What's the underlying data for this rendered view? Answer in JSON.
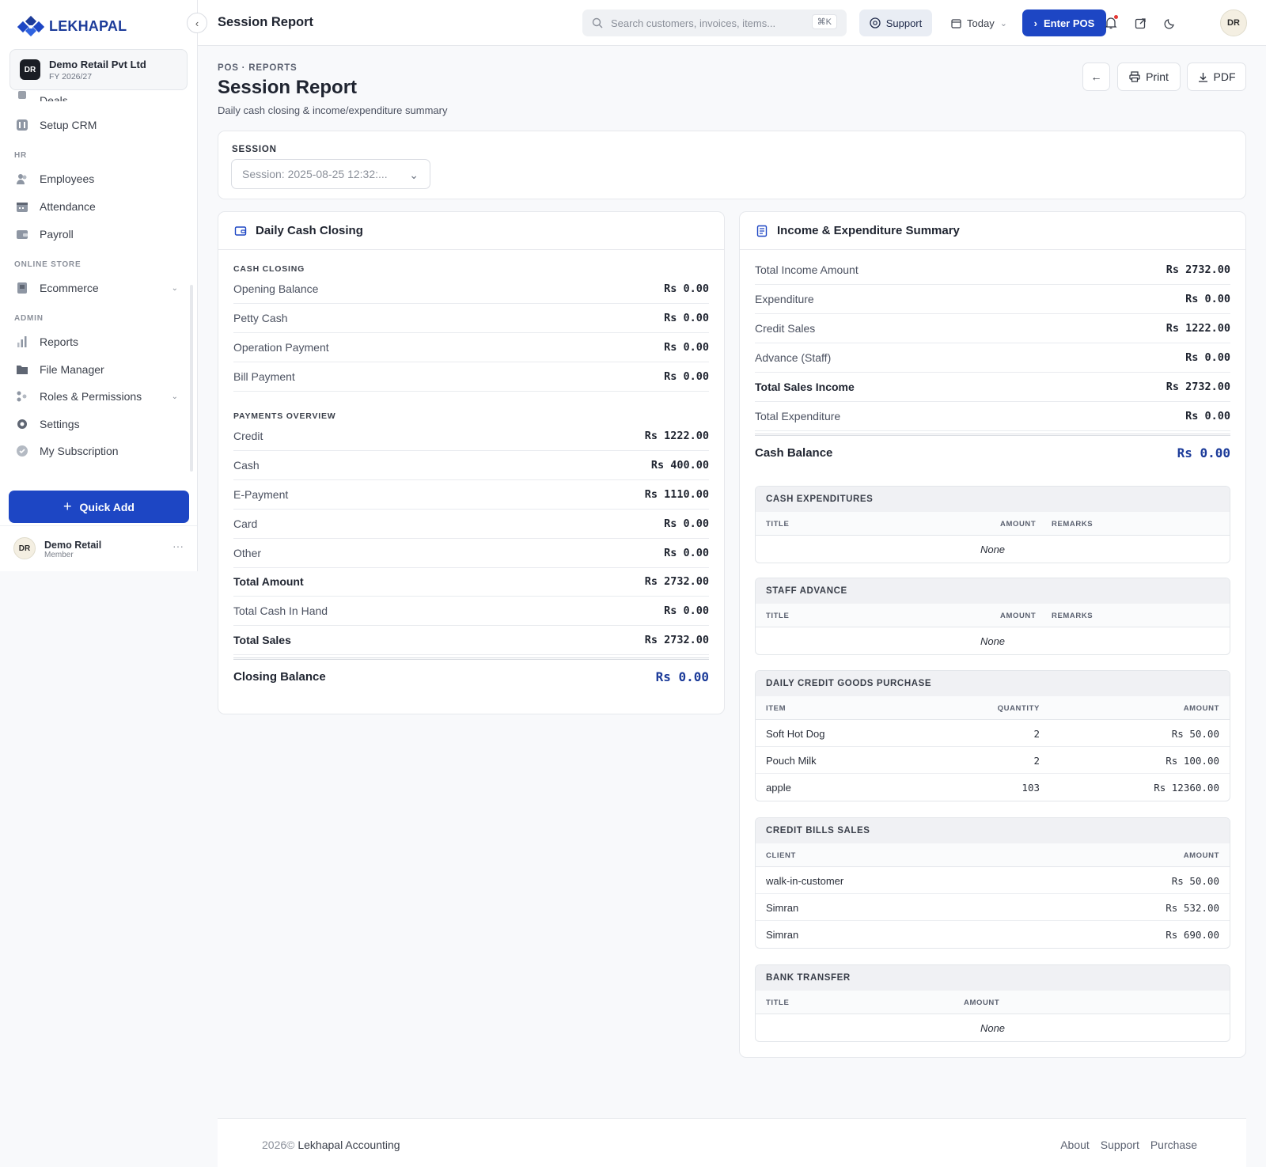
{
  "brand": {
    "name": "LEKHAPAL"
  },
  "org": {
    "badge": "DR",
    "name": "Demo Retail Pvt Ltd",
    "fy": "FY 2026/27"
  },
  "sidebar": {
    "partial_item": "Deals",
    "items_crm": [
      {
        "label": "Setup CRM",
        "icon": "crm-setup-icon"
      }
    ],
    "section_hr": "HR",
    "items_hr": [
      {
        "label": "Employees",
        "icon": "users-icon"
      },
      {
        "label": "Attendance",
        "icon": "calendar-icon"
      },
      {
        "label": "Payroll",
        "icon": "wallet-icon"
      }
    ],
    "section_store": "ONLINE STORE",
    "items_store": [
      {
        "label": "Ecommerce",
        "icon": "store-icon"
      }
    ],
    "section_admin": "ADMIN",
    "items_admin": [
      {
        "label": "Reports",
        "icon": "bar-chart-icon"
      },
      {
        "label": "File Manager",
        "icon": "folder-icon"
      },
      {
        "label": "Roles & Permissions",
        "icon": "roles-icon"
      },
      {
        "label": "Settings",
        "icon": "gear-icon"
      },
      {
        "label": "My Subscription",
        "icon": "badge-check-icon"
      }
    ],
    "quick_add": "Quick Add",
    "user": {
      "initials": "DR",
      "name": "Demo Retail",
      "role": "Member"
    }
  },
  "topbar": {
    "title": "Session Report",
    "search_placeholder": "Search customers, invoices, items...",
    "shortcut": "⌘K",
    "support": "Support",
    "date_filter": "Today",
    "enter_pos": "Enter POS",
    "avatar": "DR"
  },
  "header": {
    "breadcrumb": "POS · REPORTS",
    "title": "Session Report",
    "subtitle": "Daily cash closing & income/expenditure summary",
    "print": "Print",
    "pdf": "PDF"
  },
  "session": {
    "label": "SESSION",
    "value": "Session: 2025-08-25 12:32:..."
  },
  "cash_closing": {
    "title": "Daily Cash Closing",
    "section_cash": "CASH CLOSING",
    "cash_rows": [
      {
        "label": "Opening Balance",
        "value": "Rs 0.00"
      },
      {
        "label": "Petty Cash",
        "value": "Rs 0.00"
      },
      {
        "label": "Operation Payment",
        "value": "Rs 0.00"
      },
      {
        "label": "Bill Payment",
        "value": "Rs 0.00"
      }
    ],
    "section_payments": "PAYMENTS OVERVIEW",
    "payment_rows": [
      {
        "label": "Credit",
        "value": "Rs 1222.00"
      },
      {
        "label": "Cash",
        "value": "Rs 400.00"
      },
      {
        "label": "E-Payment",
        "value": "Rs 1110.00"
      },
      {
        "label": "Card",
        "value": "Rs 0.00"
      },
      {
        "label": "Other",
        "value": "Rs 0.00"
      },
      {
        "label": "Total Amount",
        "value": "Rs 2732.00"
      },
      {
        "label": "Total Cash In Hand",
        "value": "Rs 0.00"
      },
      {
        "label": "Total Sales",
        "value": "Rs 2732.00"
      }
    ],
    "closing": {
      "label": "Closing Balance",
      "value": "Rs 0.00"
    }
  },
  "summary": {
    "title": "Income & Expenditure Summary",
    "rows": [
      {
        "label": "Total Income Amount",
        "value": "Rs 2732.00"
      },
      {
        "label": "Expenditure",
        "value": "Rs 0.00"
      },
      {
        "label": "Credit Sales",
        "value": "Rs 1222.00"
      },
      {
        "label": "Advance (Staff)",
        "value": "Rs 0.00"
      },
      {
        "label": "Total Sales Income",
        "value": "Rs 2732.00"
      },
      {
        "label": "Total Expenditure",
        "value": "Rs 0.00"
      }
    ],
    "cash_balance": {
      "label": "Cash Balance",
      "value": "Rs 0.00"
    },
    "cash_expenditures": {
      "title": "CASH EXPENDITURES",
      "headers": [
        "TITLE",
        "AMOUNT",
        "REMARKS"
      ],
      "empty": "None"
    },
    "staff_advance": {
      "title": "STAFF ADVANCE",
      "headers": [
        "TITLE",
        "AMOUNT",
        "REMARKS"
      ],
      "empty": "None"
    },
    "credit_goods": {
      "title": "DAILY CREDIT GOODS PURCHASE",
      "headers": [
        "ITEM",
        "QUANTITY",
        "AMOUNT"
      ],
      "rows": [
        {
          "item": "Soft Hot Dog",
          "qty": "2",
          "amount": "Rs 50.00"
        },
        {
          "item": "Pouch Milk",
          "qty": "2",
          "amount": "Rs 100.00"
        },
        {
          "item": "apple",
          "qty": "103",
          "amount": "Rs 12360.00"
        }
      ]
    },
    "credit_bills": {
      "title": "CREDIT BILLS SALES",
      "headers": [
        "CLIENT",
        "AMOUNT"
      ],
      "rows": [
        {
          "client": "walk-in-customer",
          "amount": "Rs 50.00"
        },
        {
          "client": "Simran",
          "amount": "Rs 532.00"
        },
        {
          "client": "Simran",
          "amount": "Rs 690.00"
        }
      ]
    },
    "bank_transfer": {
      "title": "BANK TRANSFER",
      "headers": [
        "TITLE",
        "AMOUNT"
      ],
      "empty": "None"
    }
  },
  "footer": {
    "year": "2026©",
    "company": "Lekhapal Accounting",
    "links": [
      "About",
      "Support",
      "Purchase"
    ]
  },
  "colors": {
    "primary": "#1d46c4",
    "brand": "#1d3c9a",
    "accent_value": "#1d3c9a"
  }
}
